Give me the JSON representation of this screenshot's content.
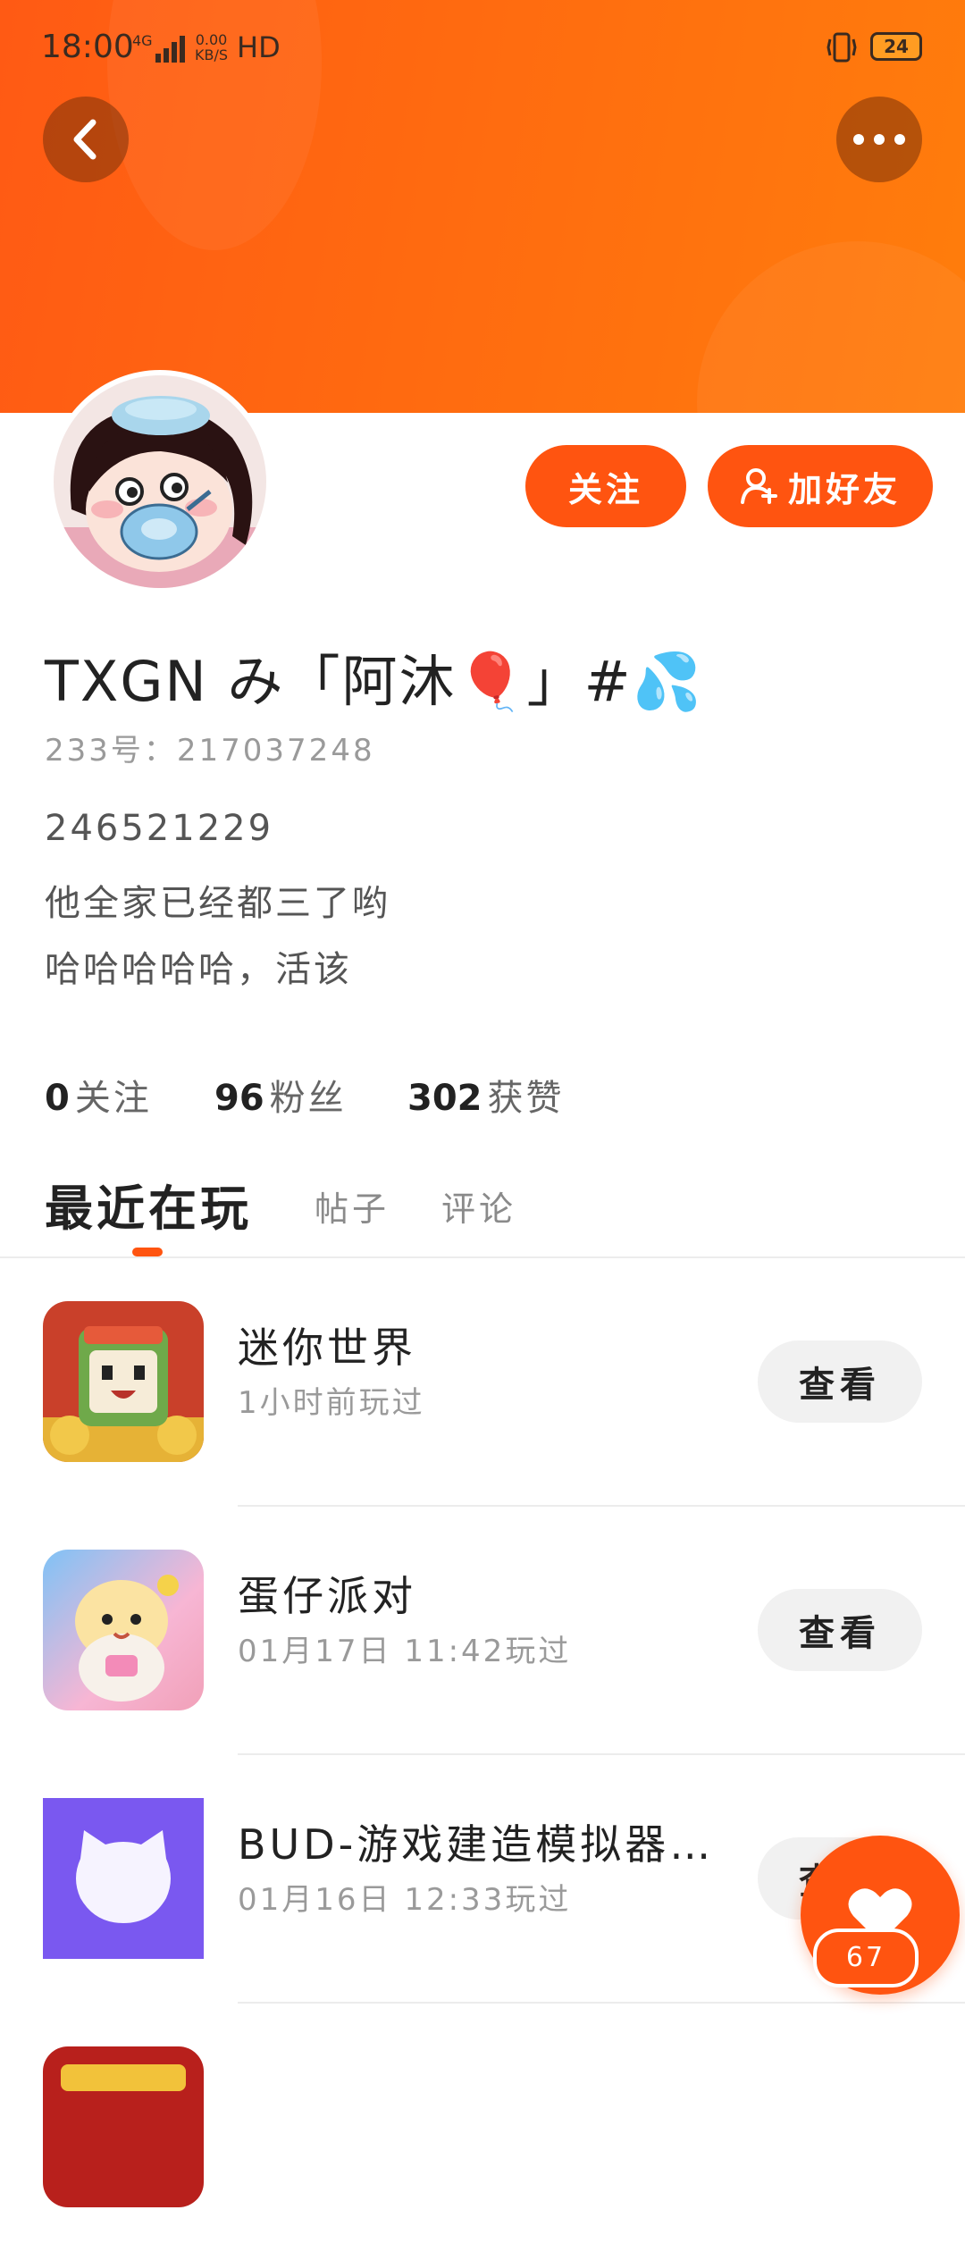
{
  "status_bar": {
    "time": "18:00",
    "network": "4G",
    "speed_value": "0.00",
    "speed_unit": "KB/S",
    "hd": "HD",
    "battery": "24"
  },
  "header": {
    "back_icon": "chevron-left-icon",
    "more_icon": "more-dots-icon",
    "gradient_start": "#ff5a14",
    "gradient_end": "#ff7d0c"
  },
  "profile": {
    "nickname": "TXGN み「阿沐🎈」#💦",
    "user_id": "233号：217037248",
    "bio": [
      "246521229",
      "他全家已经都三了哟",
      "哈哈哈哈哈，活该"
    ],
    "follow_label": "关注",
    "add_friend_label": "加好友"
  },
  "stats": [
    {
      "value": "0",
      "label": "关注"
    },
    {
      "value": "96",
      "label": "粉丝"
    },
    {
      "value": "302",
      "label": "获赞"
    }
  ],
  "tabs": [
    {
      "label": "最近在玩",
      "active": true
    },
    {
      "label": "帖子"
    },
    {
      "label": "评论"
    }
  ],
  "games": [
    {
      "title": "迷你世界",
      "time": "1小时前玩过",
      "button": "查看"
    },
    {
      "title": "蛋仔派对",
      "time": "01月17日 11:42玩过",
      "button": "查看"
    },
    {
      "title": "BUD-游戏建造模拟器 …",
      "time": "01月16日 12:33玩过",
      "button": "查看"
    }
  ],
  "like": {
    "count": "67",
    "accent": "#ff5410"
  }
}
